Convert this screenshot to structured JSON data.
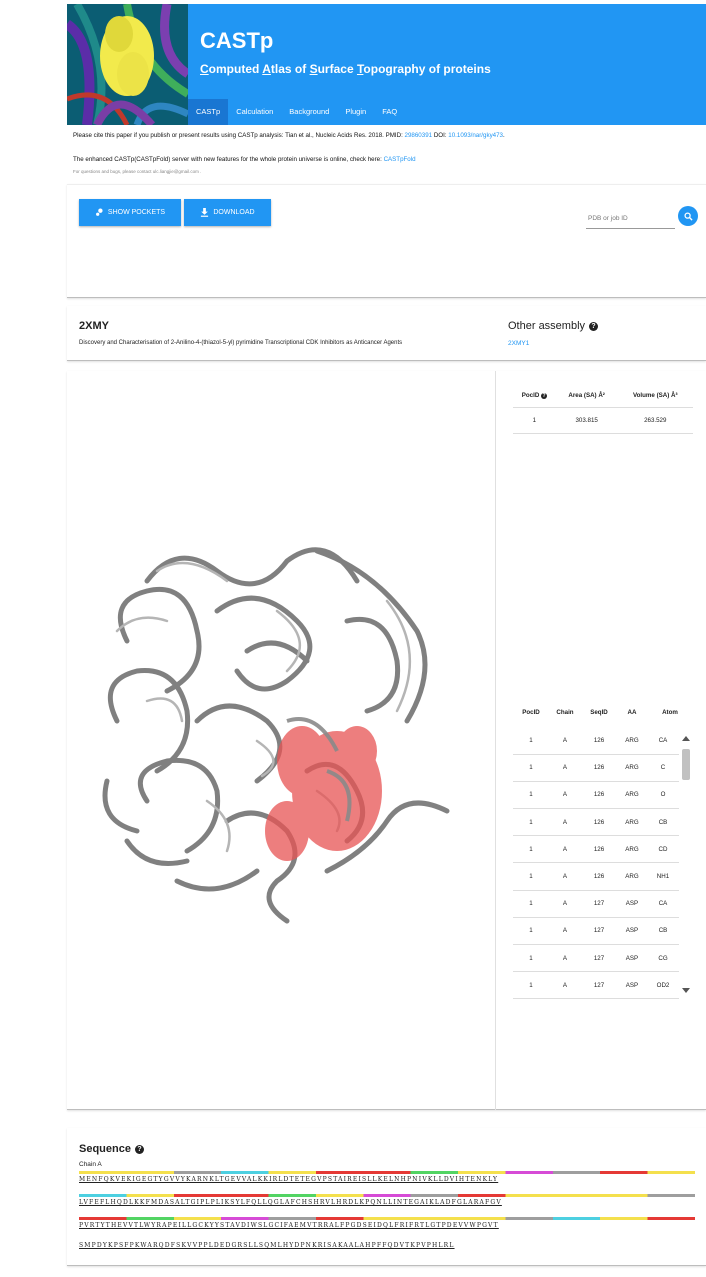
{
  "header": {
    "title": "CASTp",
    "subtitle_parts": [
      {
        "u": "C",
        "t": "omputed "
      },
      {
        "u": "A",
        "t": "tlas of "
      },
      {
        "u": "S",
        "t": "urface "
      },
      {
        "u": "T",
        "t": "opography of proteins"
      }
    ],
    "nav": [
      "CASTp",
      "Calculation",
      "Background",
      "Plugin",
      "FAQ"
    ],
    "active_nav": "CASTp"
  },
  "notices": {
    "cite_text": "Please cite this paper if you publish or present results using CASTp analysis: Tian et al., Nucleic Acids Res. 2018. PMID:",
    "pmid": "29860391",
    "doi_label": "DOI:",
    "doi": "10.1093/nar/gky473",
    "enhanced_text": "The enhanced CASTp(CASTpFold) server with new features for the whole protein universe is online, check here:",
    "enhanced_link": "CASTpFold",
    "contact": "For questions and bugs, please contact ulc.liangjie@gmail.com ."
  },
  "tools": {
    "show_pockets": "SHOW POCKETS",
    "download": "DOWNLOAD",
    "search_placeholder": "PDB or job ID"
  },
  "structure": {
    "pdb_id": "2XMY",
    "description": "Discovery and Characterisation of 2-Anilino-4-(thiazol-5-yl) pyrimidine Transcriptional CDK Inhibitors as Anticancer Agents",
    "other_assembly_title": "Other assembly",
    "other_assembly_link": "2XMY1"
  },
  "pocket_table": {
    "headers": [
      "PocID",
      "Area (SA) Å²",
      "Volume (SA) Å³"
    ],
    "rows": [
      [
        "1",
        "303.815",
        "263.529"
      ]
    ]
  },
  "atom_table": {
    "headers": [
      "PocID",
      "Chain",
      "SeqID",
      "AA",
      "Atom"
    ],
    "rows": [
      [
        "1",
        "A",
        "126",
        "ARG",
        "CA"
      ],
      [
        "1",
        "A",
        "126",
        "ARG",
        "C"
      ],
      [
        "1",
        "A",
        "126",
        "ARG",
        "O"
      ],
      [
        "1",
        "A",
        "126",
        "ARG",
        "CB"
      ],
      [
        "1",
        "A",
        "126",
        "ARG",
        "CD"
      ],
      [
        "1",
        "A",
        "126",
        "ARG",
        "NH1"
      ],
      [
        "1",
        "A",
        "127",
        "ASP",
        "CA"
      ],
      [
        "1",
        "A",
        "127",
        "ASP",
        "CB"
      ],
      [
        "1",
        "A",
        "127",
        "ASP",
        "CG"
      ],
      [
        "1",
        "A",
        "127",
        "ASP",
        "OD2"
      ]
    ]
  },
  "sequence": {
    "title": "Sequence",
    "chain": "Chain A",
    "lines": [
      "MENFQKVEKIGEGTYGVVYKARNKLTGEVVALKKIRLDTETEGVPSTAIREISLLKELNHPNIVKLLDVIHTENKLY",
      "LVFEFLHQDLKKFMDASALTGIPLPLIKSYLFQLLQGLAFCHSHRVLHRDLKPQNLLINTEGAIKLADFGLARAFGV",
      "PVRTYTHEVVTLWYRAPEILLGCKYYSTAVDIWSLGCIFAEMVTRRALFPGDSEIDQLFRIFRTLGTPDEVVWPGVT",
      "SMPDYKPSFPKWARQDFSKVVPPLDEDGRSLLSQMLHYDPNKRISAKAALAHPFFQDVTKPVPHLRL"
    ],
    "colors": {
      "red": "#e53935",
      "yellow": "#f4e04d",
      "green": "#52d463",
      "gray": "#9e9e9e",
      "cyan": "#4dd0e1",
      "magenta": "#d64bd6",
      "highlight": "#bcd0e2"
    }
  }
}
